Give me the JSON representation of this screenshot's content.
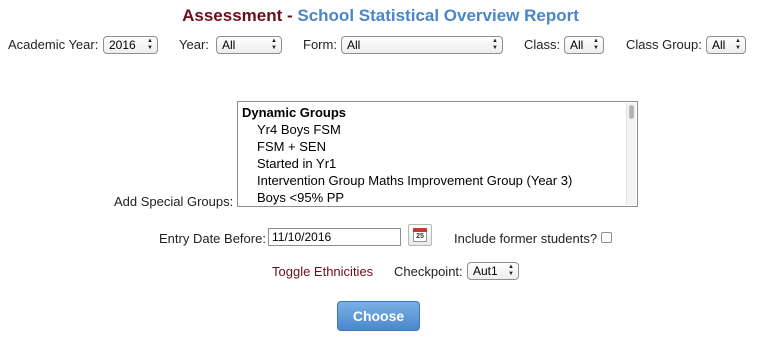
{
  "header": {
    "title_part1": "Assessment",
    "separator": " - ",
    "title_part2": "School Statistical Overview Report"
  },
  "filters": {
    "academic_year": {
      "label": "Academic Year:",
      "value": "2016"
    },
    "year": {
      "label": "Year:",
      "value": "All"
    },
    "form": {
      "label": "Form:",
      "value": "All"
    },
    "class": {
      "label": "Class:",
      "value": "All"
    },
    "class_group": {
      "label": "Class Group:",
      "value": "All"
    }
  },
  "special_groups": {
    "label": "Add Special Groups:",
    "group_heading": "Dynamic Groups",
    "options": [
      "Yr4 Boys FSM",
      "FSM + SEN",
      "Started in Yr1",
      "Intervention Group Maths Improvement Group (Year 3)",
      "Boys <95% PP"
    ]
  },
  "entry_date": {
    "label": "Entry Date Before:",
    "value": "11/10/2016",
    "calendar_day": "25"
  },
  "former_students": {
    "label": "Include former students?",
    "checked": false
  },
  "toggle_ethnicities": "Toggle Ethnicities",
  "checkpoint": {
    "label": "Checkpoint:",
    "value": "Aut1"
  },
  "choose_button": "Choose",
  "colors": {
    "title_dark": "#6b0f1a",
    "title_blue": "#4a86c8",
    "button_blue": "#4a88cc",
    "link": "#6b0f1a"
  },
  "icons": {
    "calendar": "calendar-icon",
    "select_arrows": "updown-arrows-icon"
  }
}
